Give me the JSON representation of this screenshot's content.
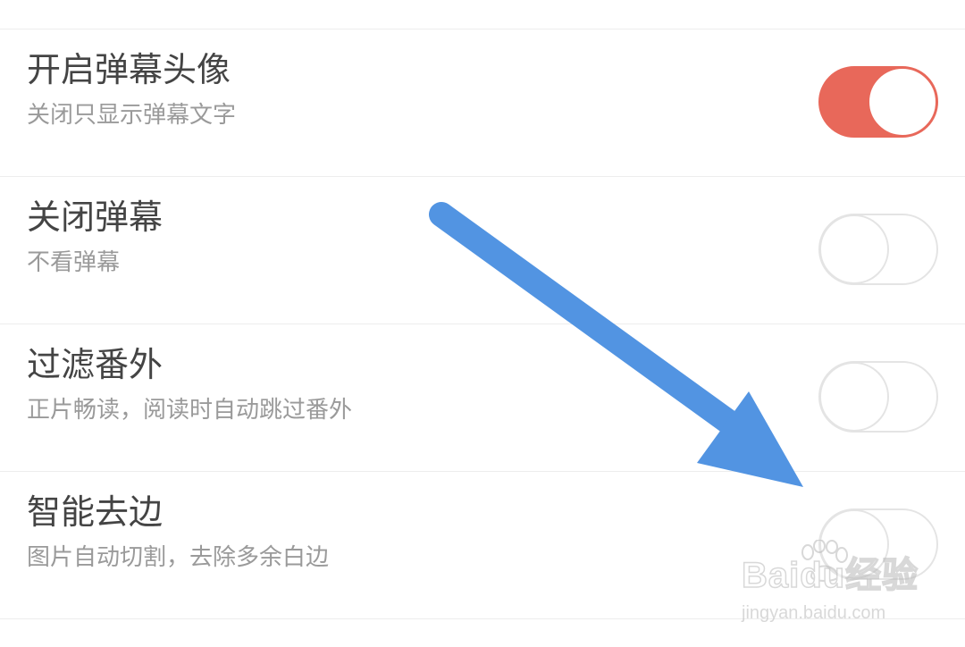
{
  "settings": {
    "items": [
      {
        "title": "开启弹幕头像",
        "subtitle": "关闭只显示弹幕文字",
        "enabled": true
      },
      {
        "title": "关闭弹幕",
        "subtitle": "不看弹幕",
        "enabled": false
      },
      {
        "title": "过滤番外",
        "subtitle": "正片畅读，阅读时自动跳过番外",
        "enabled": false
      },
      {
        "title": "智能去边",
        "subtitle": "图片自动切割，去除多余白边",
        "enabled": false
      }
    ]
  },
  "colors": {
    "toggle_on": "#e8685a",
    "toggle_off_border": "#e4e4e4",
    "arrow": "#5294e2",
    "title_text": "#444444",
    "subtitle_text": "#9a9a9a"
  },
  "watermark": {
    "brand": "Baidu经验",
    "url": "jingyan.baidu.com"
  }
}
